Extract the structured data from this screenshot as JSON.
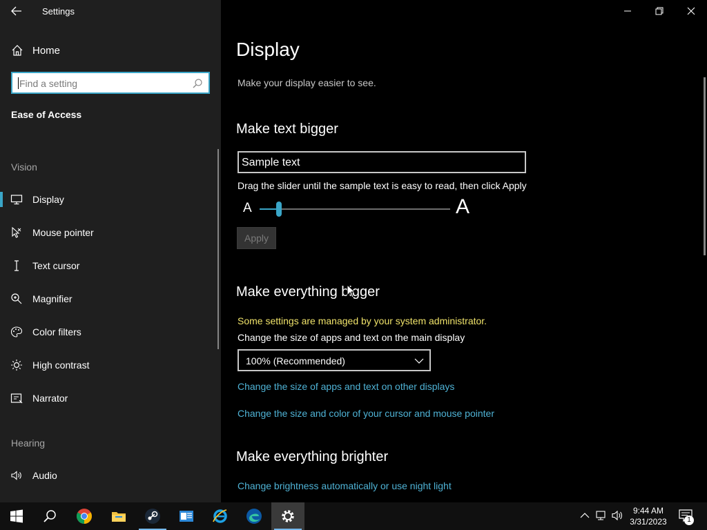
{
  "window": {
    "title": "Settings"
  },
  "sidebar": {
    "home_label": "Home",
    "search_placeholder": "Find a setting",
    "section": "Ease of Access",
    "groups": [
      {
        "label": "Vision",
        "items": [
          {
            "label": "Display",
            "icon": "monitor-icon",
            "active": true
          },
          {
            "label": "Mouse pointer",
            "icon": "mouse-pointer-icon"
          },
          {
            "label": "Text cursor",
            "icon": "text-cursor-icon"
          },
          {
            "label": "Magnifier",
            "icon": "magnifier-icon"
          },
          {
            "label": "Color filters",
            "icon": "color-palette-icon"
          },
          {
            "label": "High contrast",
            "icon": "brightness-icon"
          },
          {
            "label": "Narrator",
            "icon": "narrator-icon"
          }
        ]
      },
      {
        "label": "Hearing",
        "items": [
          {
            "label": "Audio",
            "icon": "speaker-icon"
          }
        ]
      }
    ]
  },
  "main": {
    "title": "Display",
    "subtitle": "Make your display easier to see.",
    "text_bigger": {
      "heading": "Make text bigger",
      "sample": "Sample text",
      "hint": "Drag the slider until the sample text is easy to read, then click Apply",
      "a_small": "A",
      "a_large": "A",
      "slider_value": 0.1,
      "apply_label": "Apply"
    },
    "everything_bigger": {
      "heading": "Make everything bigger",
      "managed_notice": "Some settings are managed by your system administrator.",
      "scale_label": "Change the size of apps and text on the main display",
      "scale_value": "100% (Recommended)",
      "link_other_displays": "Change the size of apps and text on other displays",
      "link_cursor": "Change the size and color of your cursor and mouse pointer"
    },
    "brighter": {
      "heading": "Make everything brighter",
      "link_brightness": "Change brightness automatically or use night light"
    }
  },
  "taskbar": {
    "apps": [
      "start-icon",
      "search-icon",
      "chrome-icon",
      "file-explorer-icon",
      "steam-icon",
      "mail-app-icon",
      "internet-explorer-icon",
      "edge-icon",
      "settings-icon"
    ],
    "time": "9:44 AM",
    "date": "3/31/2023",
    "notification_count": "1"
  },
  "colors": {
    "accent": "#3aa6c8",
    "link": "#4fb3d6",
    "warning": "#f0e36a",
    "sidebar_bg": "#1f1f1f",
    "main_bg": "#000000"
  }
}
